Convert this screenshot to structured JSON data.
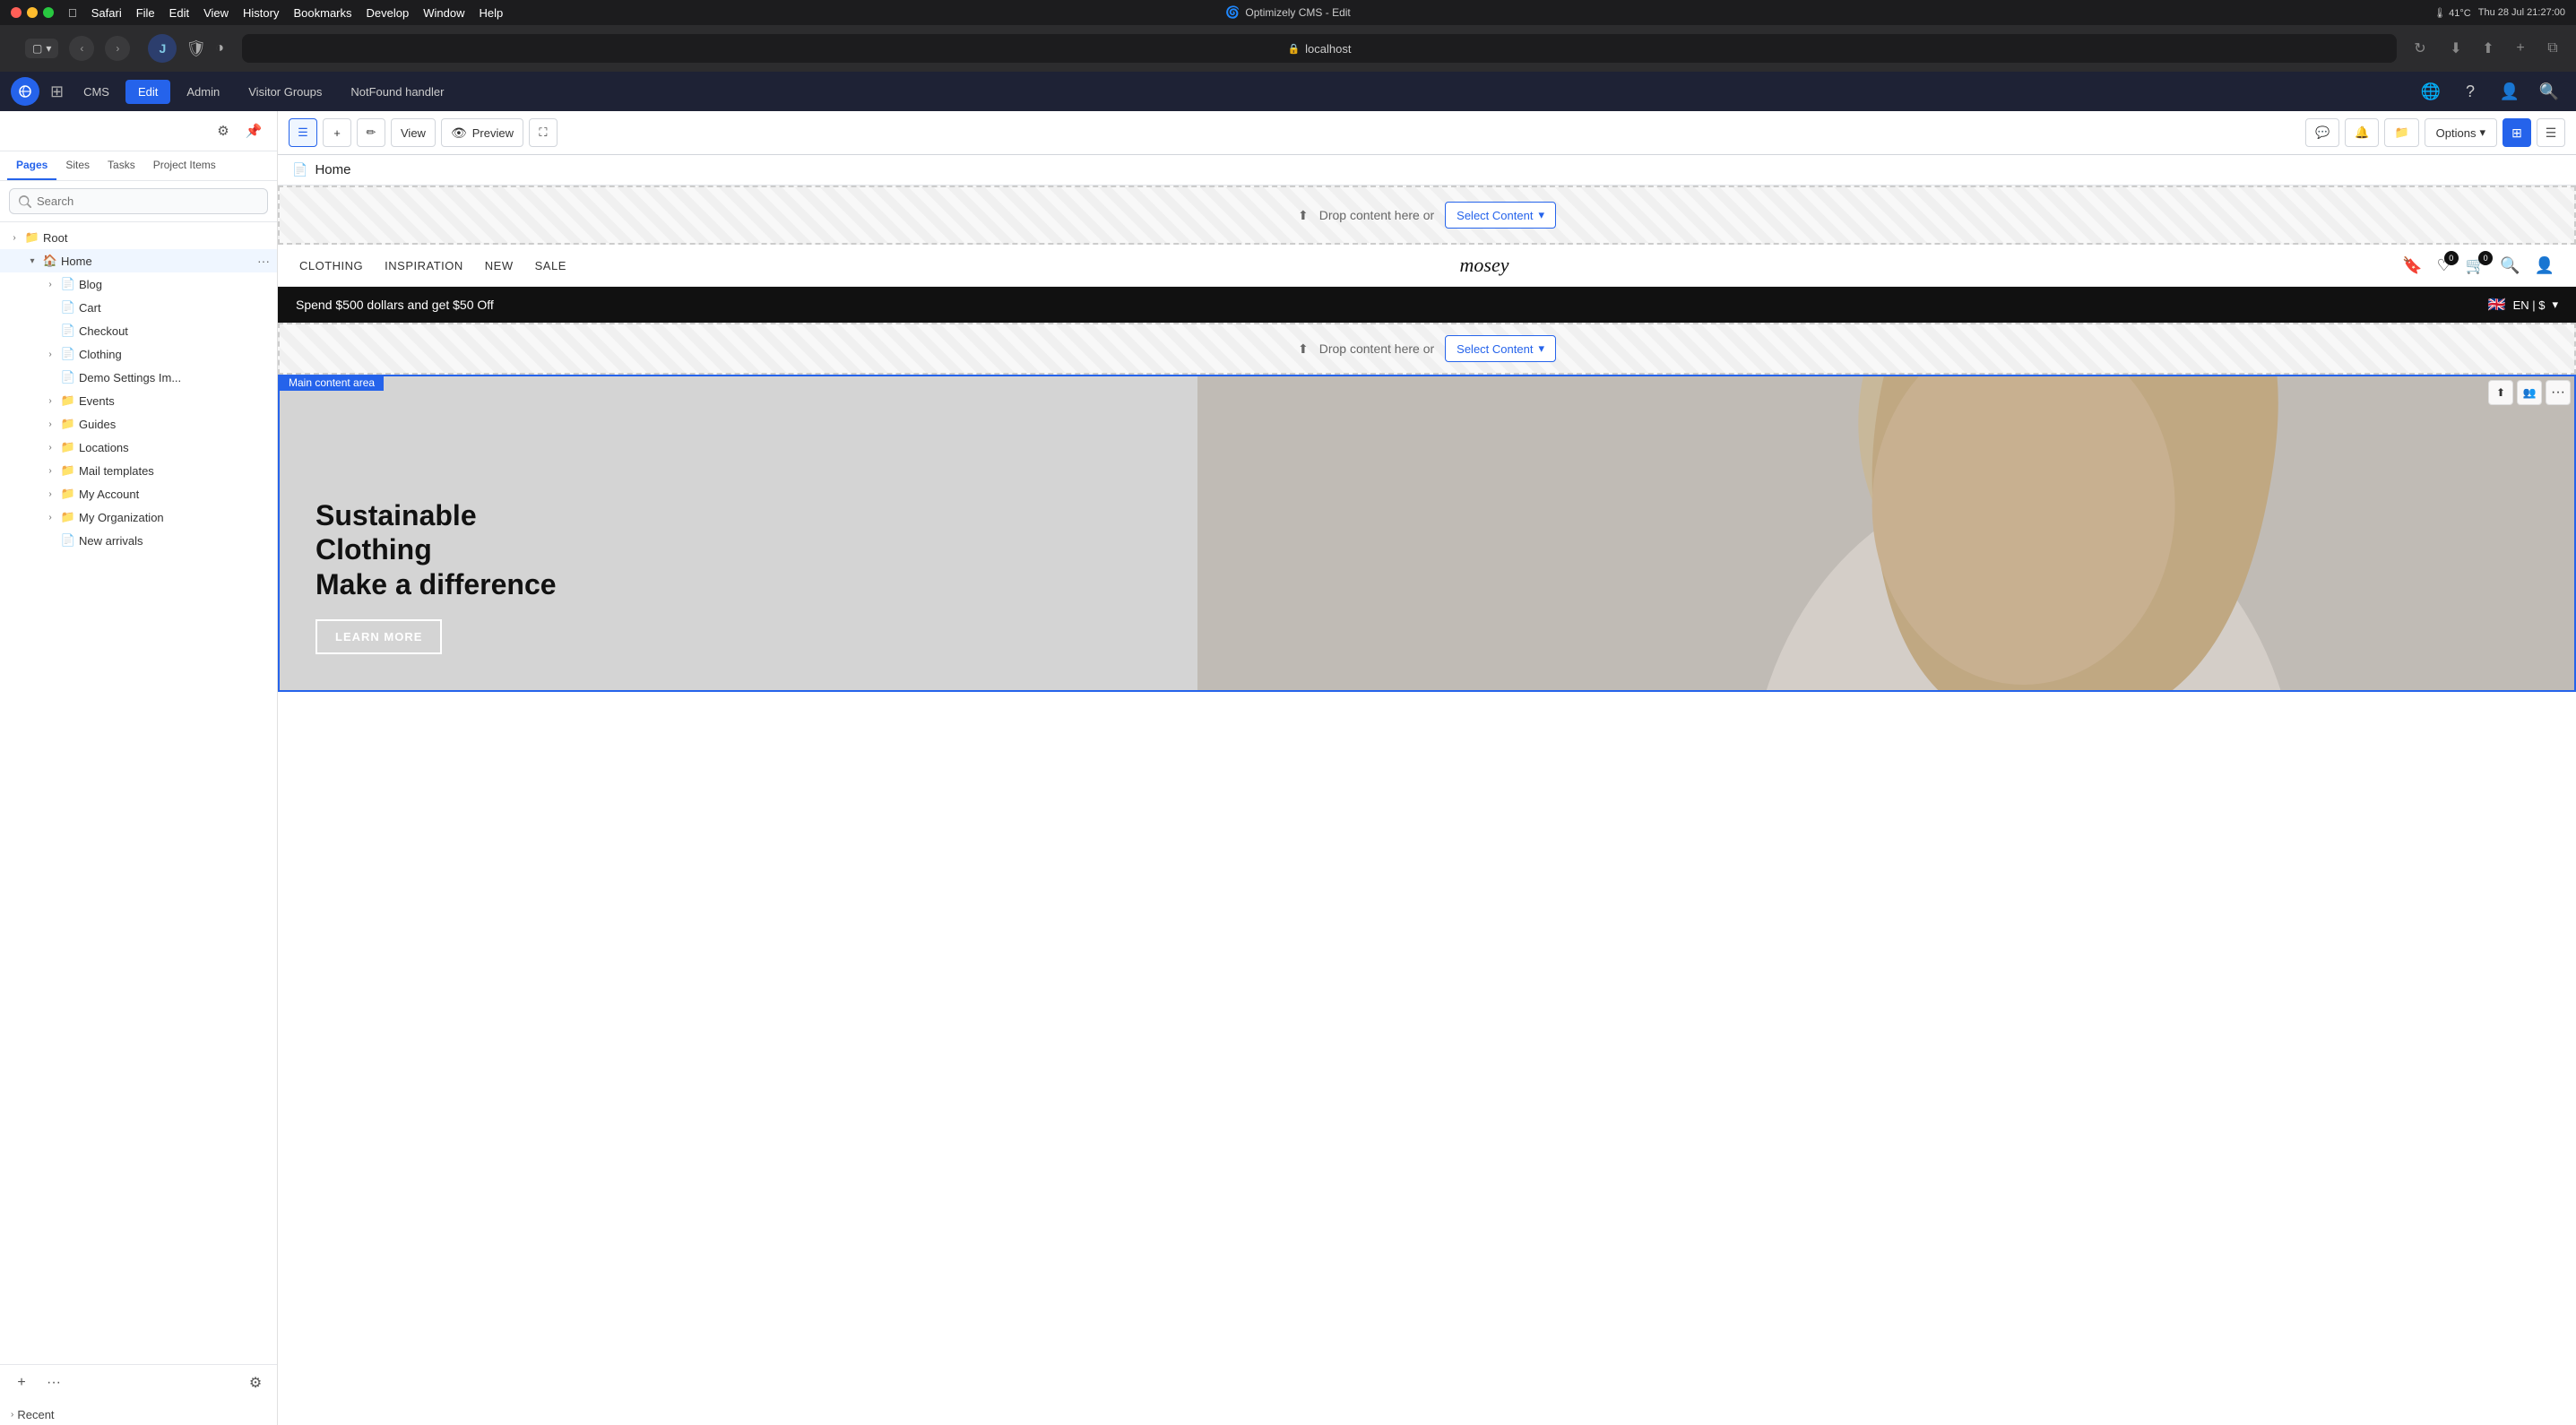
{
  "mac": {
    "menu_items": [
      "Apple",
      "Safari",
      "File",
      "Edit",
      "View",
      "History",
      "Bookmarks",
      "Develop",
      "Window",
      "Help"
    ],
    "title": "Optimizely CMS - Edit",
    "time": "Thu 28 Jul 21:27:00",
    "url": "localhost"
  },
  "cms": {
    "logo_letter": "J",
    "nav_items": [
      "CMS",
      "Edit",
      "Admin",
      "Visitor Groups",
      "NotFound handler"
    ]
  },
  "sidebar": {
    "tabs": [
      "Pages",
      "Sites",
      "Tasks",
      "Project Items"
    ],
    "search_placeholder": "Search",
    "tree": {
      "root_label": "Root",
      "home_label": "Home",
      "blog_label": "Blog",
      "cart_label": "Cart",
      "checkout_label": "Checkout",
      "clothing_label": "Clothing",
      "demo_label": "Demo Settings Im...",
      "events_label": "Events",
      "guides_label": "Guides",
      "locations_label": "Locations",
      "mail_templates_label": "Mail templates",
      "my_account_label": "My Account",
      "my_organization_label": "My Organization",
      "new_arrivals_label": "New arrivals"
    },
    "recent_label": "Recent"
  },
  "toolbar": {
    "list_icon": "☰",
    "add_icon": "+",
    "edit_icon": "✏",
    "view_label": "View",
    "preview_label": "Preview",
    "fullscreen_icon": "⛶",
    "options_label": "Options",
    "page_name": "Home"
  },
  "preview": {
    "promo_text": "Spend $500 dollars and get $50 Off",
    "lang_flag": "🇬🇧",
    "lang_label": "EN | $",
    "nav_links": [
      "CLOTHING",
      "INSPIRATION",
      "NEW",
      "SALE"
    ],
    "logo": "mosey",
    "wishlist_count": "0",
    "cart_count": "0",
    "drop_zone_text": "Drop content here or",
    "select_content_label": "Select Content",
    "main_content_area_label": "Main content area",
    "hero_title_line1": "Sustainable Clothing",
    "hero_title_line2": "Make a difference",
    "hero_cta": "LEARN MORE"
  },
  "icons": {
    "search": "🔍",
    "bell": "🔔",
    "user": "👤",
    "globe": "🌐",
    "question": "?",
    "gear": "⚙",
    "pin": "📌",
    "share": "⬆",
    "bookmark": "🔖",
    "heart": "♡",
    "cart": "🛒",
    "chevron_down": "▾",
    "chevron_right": "›",
    "dots": "···",
    "grid": "⊞"
  }
}
